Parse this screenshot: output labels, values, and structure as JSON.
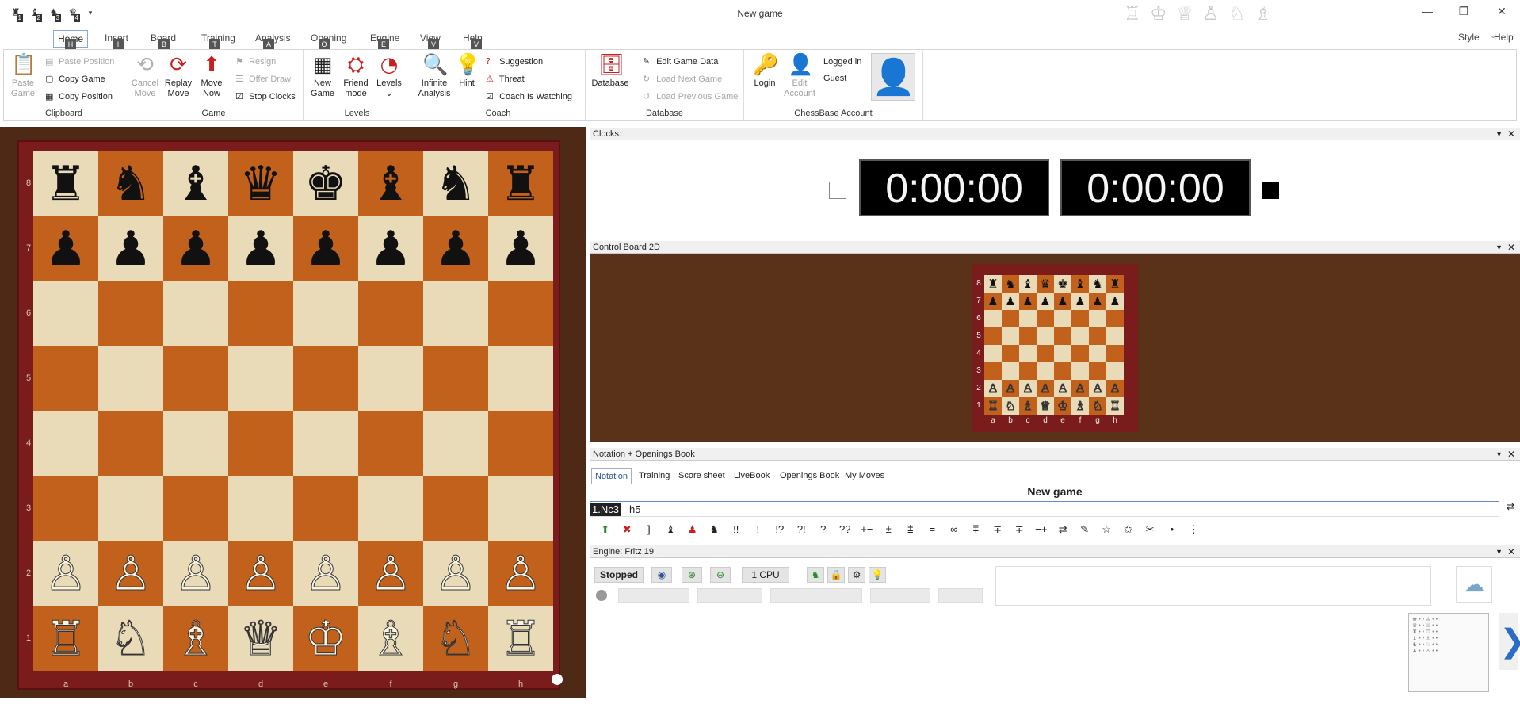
{
  "window": {
    "title": "New game",
    "min": "—",
    "restore": "❐",
    "close": "✕"
  },
  "quickaccess": [
    {
      "icon": "♜",
      "num": "1"
    },
    {
      "icon": "♝",
      "num": "2"
    },
    {
      "icon": "♞",
      "num": "3"
    },
    {
      "icon": "♛",
      "num": "4"
    }
  ],
  "title_pieces": [
    "♖",
    "♔",
    "♕",
    "♙",
    "♘",
    "♗"
  ],
  "menus": [
    {
      "label": "Home",
      "key": "H"
    },
    {
      "label": "Insert",
      "key": "I"
    },
    {
      "label": "Board",
      "key": "B"
    },
    {
      "label": "Training",
      "key": "T"
    },
    {
      "label": "Analysis",
      "key": "A"
    },
    {
      "label": "Opening",
      "key": "O"
    },
    {
      "label": "Engine",
      "key": "E"
    },
    {
      "label": "View",
      "key": "V"
    },
    {
      "label": "Help",
      "key": "V"
    }
  ],
  "file_key": "F",
  "style_label": "Style",
  "help_label": "Help",
  "ribbon": {
    "clipboard": {
      "label": "Clipboard",
      "paste": "Paste\nGame",
      "paste_line1": "Paste",
      "paste_line2": "Game",
      "paste_position": "Paste Position",
      "copy_game": "Copy Game",
      "copy_position": "Copy Position"
    },
    "game": {
      "label": "Game",
      "cancel1": "Cancel",
      "cancel2": "Move",
      "replay1": "Replay",
      "replay2": "Move",
      "movenow1": "Move",
      "movenow2": "Now",
      "resign": "Resign",
      "offer_draw": "Offer Draw",
      "stop_clocks": "Stop Clocks"
    },
    "levels": {
      "label": "Levels",
      "new1": "New",
      "new2": "Game",
      "friend1": "Friend",
      "friend2": "mode",
      "levels": "Levels"
    },
    "coach": {
      "label": "Coach",
      "infinite1": "Infinite",
      "infinite2": "Analysis",
      "hint": "Hint",
      "suggestion": "Suggestion",
      "threat": "Threat",
      "coach_watching": "Coach Is Watching"
    },
    "database": {
      "label": "Database",
      "database": "Database",
      "edit_game_data": "Edit Game Data",
      "load_next": "Load Next Game",
      "load_prev": "Load Previous Game"
    },
    "account": {
      "label": "ChessBase Account",
      "login": "Login",
      "edit1": "Edit",
      "edit2": "Account",
      "logged_in": "Logged in",
      "user": "Guest"
    }
  },
  "clocks": {
    "header": "Clocks:",
    "white": "0:00:00",
    "black": "0:00:00"
  },
  "control_board": {
    "header": "Control Board 2D"
  },
  "notation": {
    "header": "Notation + Openings Book",
    "tabs": [
      "Notation",
      "Training",
      "Score sheet",
      "LiveBook",
      "Openings Book",
      "My Moves"
    ],
    "title": "New game",
    "move1": "1.Nc3",
    "move2": "h5",
    "symbols": [
      "⬆",
      "✖",
      "]",
      "♝",
      "♟",
      "♞",
      "!!",
      "!",
      "!?",
      "?!",
      "?",
      "??",
      "+−",
      "±",
      "⩲",
      "=",
      "∞",
      "⩱",
      "∓",
      "∓",
      "−+",
      "⇄",
      "✎",
      "☆",
      "✩",
      "✂",
      "•",
      "⋮"
    ]
  },
  "engine": {
    "header": "Engine: Fritz 19",
    "status": "Stopped",
    "cpu": "1 CPU"
  },
  "board": {
    "ranks": [
      "8",
      "7",
      "6",
      "5",
      "4",
      "3",
      "2",
      "1"
    ],
    "files": [
      "a",
      "b",
      "c",
      "d",
      "e",
      "f",
      "g",
      "h"
    ],
    "position": [
      [
        "♜",
        "♞",
        "♝",
        "♛",
        "♚",
        "♝",
        "♞",
        "♜"
      ],
      [
        "♟",
        "♟",
        "♟",
        "♟",
        "♟",
        "♟",
        "♟",
        "♟"
      ],
      [
        "",
        "",
        "",
        "",
        "",
        "",
        "",
        ""
      ],
      [
        "",
        "",
        "",
        "",
        "",
        "",
        "",
        ""
      ],
      [
        "",
        "",
        "",
        "",
        "",
        "",
        "",
        ""
      ],
      [
        "",
        "",
        "",
        "",
        "",
        "",
        "",
        ""
      ],
      [
        "♙",
        "♙",
        "♙",
        "♙",
        "♙",
        "♙",
        "♙",
        "♙"
      ],
      [
        "♖",
        "♘",
        "♗",
        "♕",
        "♔",
        "♗",
        "♘",
        "♖"
      ]
    ]
  }
}
